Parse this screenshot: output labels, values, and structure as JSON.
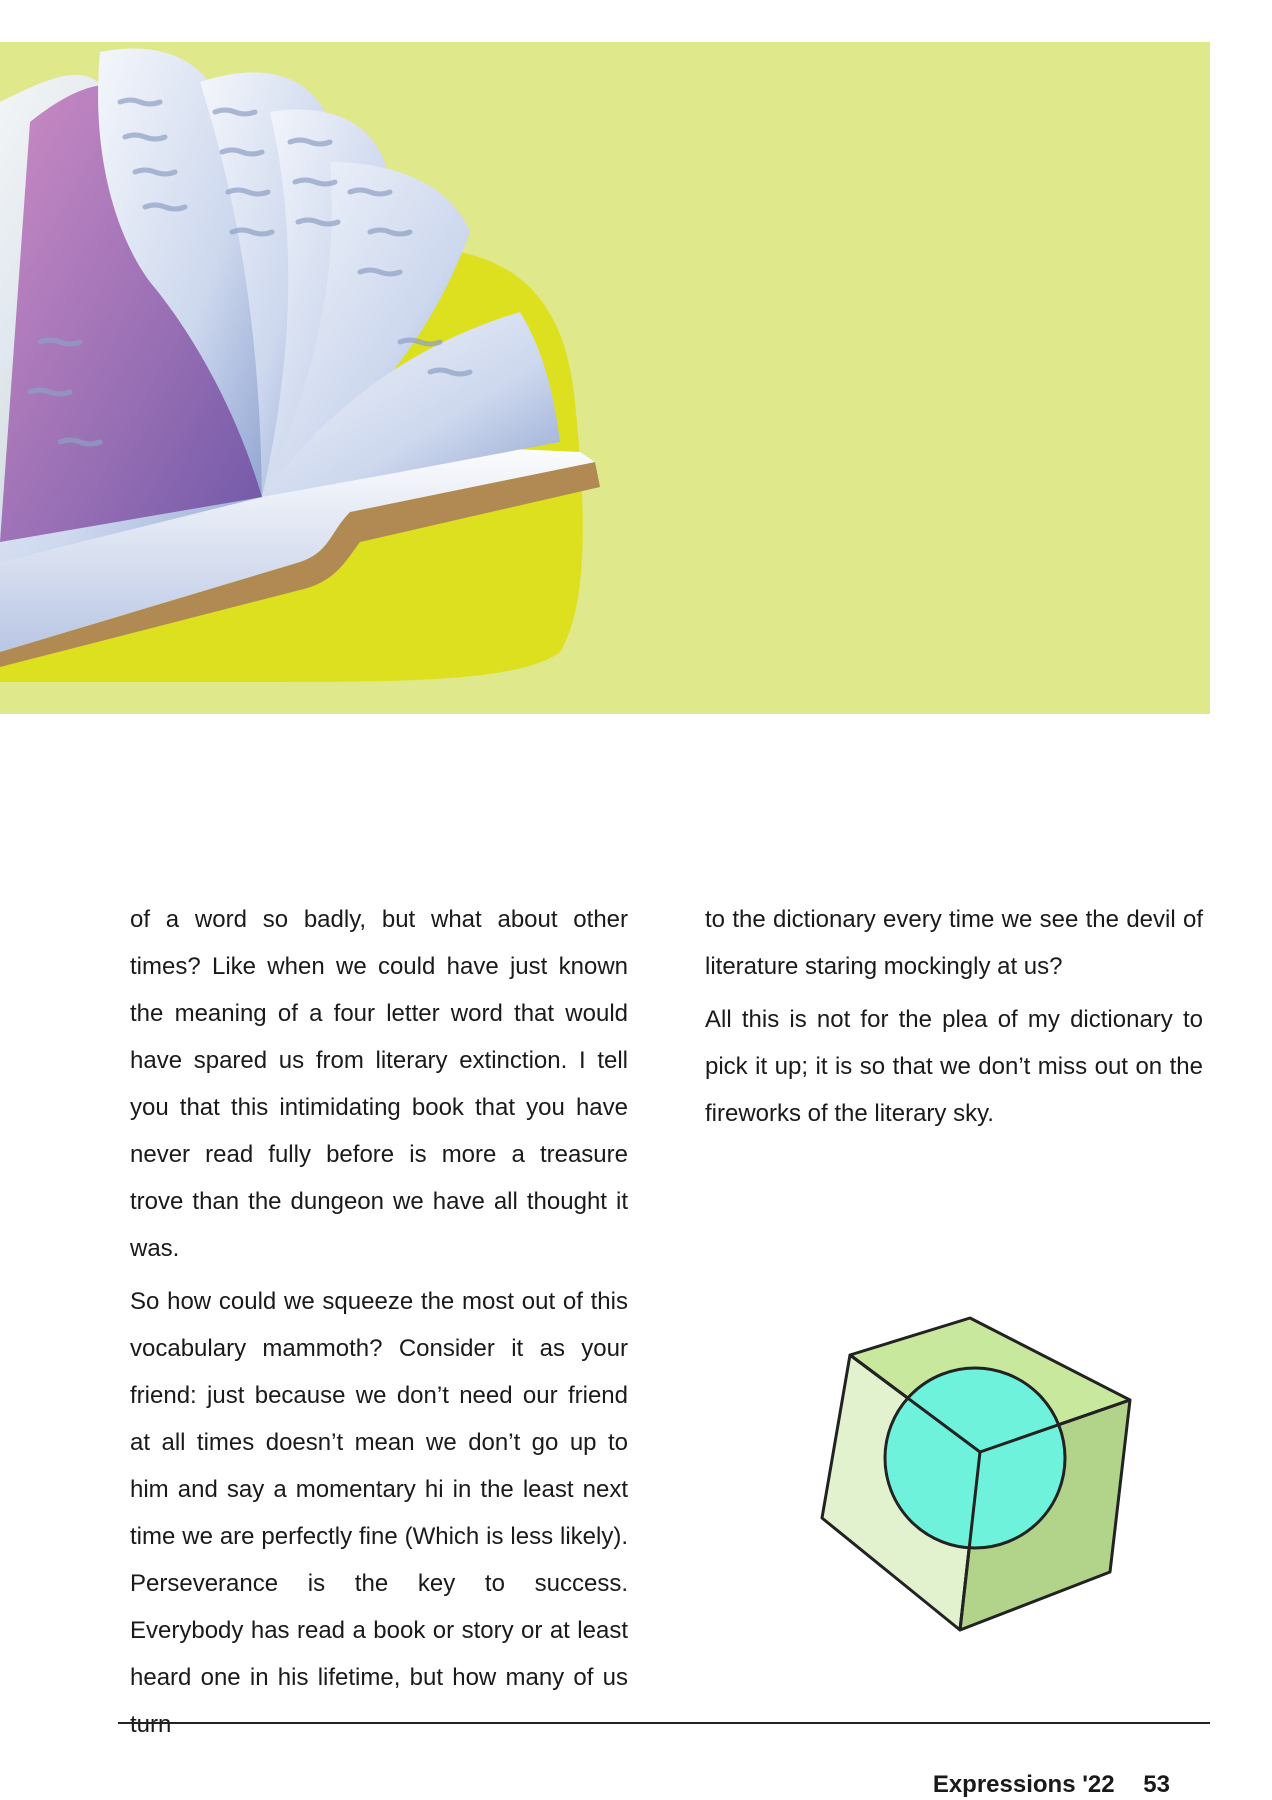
{
  "article": {
    "left_column": [
      "of a word so badly, but what about other times? Like when we could have just known the meaning of a four letter word that would have spared us from literary extinction. I tell you that this intimidating book that you have never read fully before is more a treasure trove than the dungeon we have all thought it was.",
      "So how could we squeeze the most out of this vocabulary mammoth? Consider it as your friend: just because we don’t need our friend at all times doesn’t mean we don’t go up to him and say a momentary hi in the least next time we are perfectly fine (Which is less likely). Perseverance is the key to success. Everybody has read a book or story or at least heard one in his lifetime, but how many of us turn"
    ],
    "right_column": [
      "to the dictionary every time we see the devil of literature staring mockingly at us?",
      "All this is not for the plea of my dictionary to pick it up; it is so that we don’t miss out on the fireworks of the literary sky."
    ]
  },
  "footer": {
    "publication": "Expressions '22",
    "page_number": "53"
  },
  "illustrations": {
    "banner": "open-book-illustration",
    "decoration": "cube-with-sphere-illustration"
  },
  "colors": {
    "banner_background": "#dfe88a",
    "book_blob": "#dde01e",
    "book_cover": "#b08a52",
    "cube_green": "#c2e59a",
    "sphere_cyan": "#6ff2dc"
  }
}
